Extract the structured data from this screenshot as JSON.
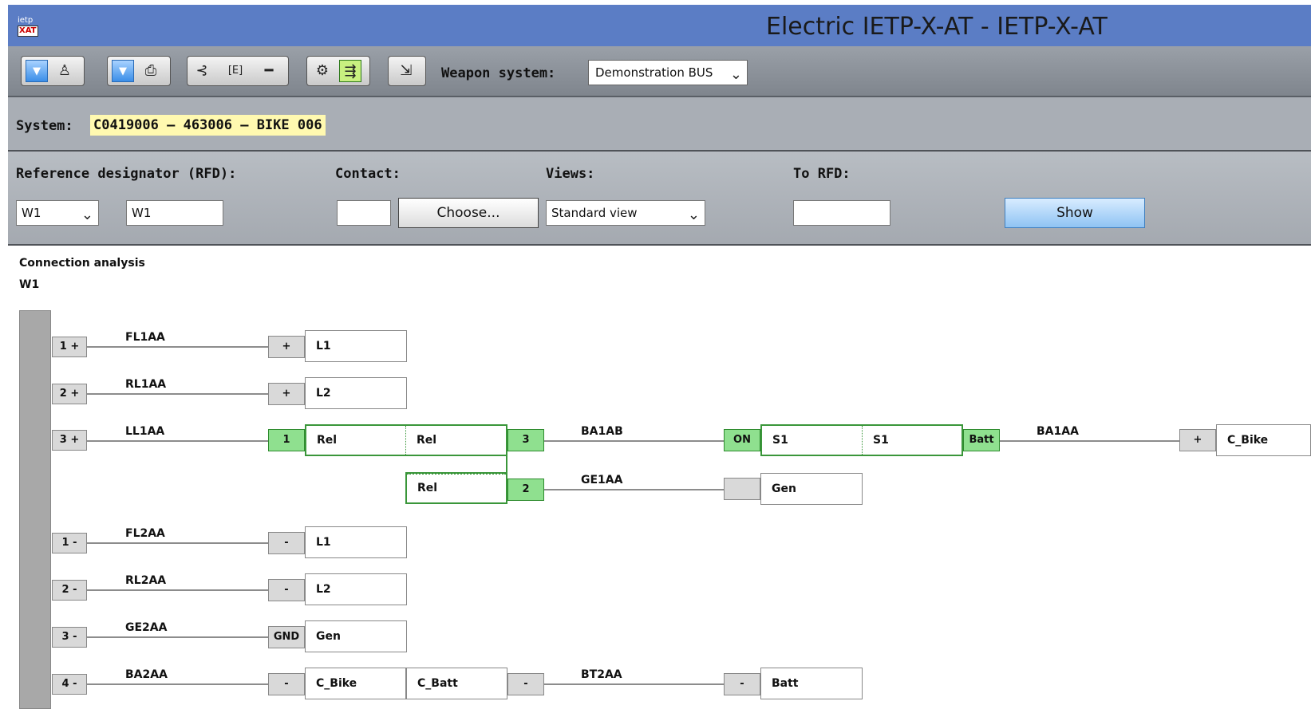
{
  "window": {
    "title": "Electric IETP-X-AT - IETP-X-AT",
    "logo_top": "ietp",
    "logo_bottom": "XAT"
  },
  "toolbar": {
    "weapon_system_label": "Weapon system:",
    "weapon_system_value": "Demonstration BUS",
    "icons": [
      "dropdown-arrow-icon",
      "person-icon",
      "dropdown-arrow-icon",
      "printer-icon",
      "branch-icon",
      "e-box-icon",
      "minus-icon",
      "network-icon",
      "connector-icon",
      "export-icon"
    ]
  },
  "system": {
    "label": "System:",
    "value": "C0419006 – 463006 – BIKE 006"
  },
  "form": {
    "rfd_label": "Reference designator (RFD):",
    "rfd_select": "W1",
    "rfd_input": "W1",
    "contact_label": "Contact:",
    "contact_input": "",
    "choose_label": "Choose...",
    "views_label": "Views:",
    "views_value": "Standard view",
    "to_rfd_label": "To RFD:",
    "to_rfd_input": "",
    "show_label": "Show"
  },
  "analysis": {
    "title": "Connection analysis",
    "subject": "W1",
    "pins": [
      "1 +",
      "2 +",
      "3 +",
      "1 -",
      "2 -",
      "3 -",
      "4 -"
    ],
    "wires": [
      "FL1AA",
      "RL1AA",
      "LL1AA",
      "FL2AA",
      "RL2AA",
      "GE2AA",
      "BA2AA",
      "BA1AB",
      "GE1AA",
      "BA1AA",
      "BT2AA"
    ],
    "terminals": {
      "t1": "+",
      "t2": "+",
      "t3": "1",
      "t4": "-",
      "t5": "-",
      "t6": "GND",
      "t7": "-",
      "rel3": "3",
      "rel2": "2",
      "on": "ON",
      "gen_empty": "",
      "batt": "Batt",
      "cbike_plus": "+",
      "cbatt_minus": "-",
      "batt_minus": "-"
    },
    "boxes": {
      "L1a": "L1",
      "L2a": "L2",
      "Rel1": "Rel",
      "Rel2": "Rel",
      "Rel3": "Rel",
      "S1a": "S1",
      "S1b": "S1",
      "Gen1": "Gen",
      "CBike1": "C_Bike",
      "L1b": "L1",
      "L2b": "L2",
      "Gen2": "Gen",
      "CBike2": "C_Bike",
      "CBatt": "C_Batt",
      "Batt": "Batt"
    }
  }
}
